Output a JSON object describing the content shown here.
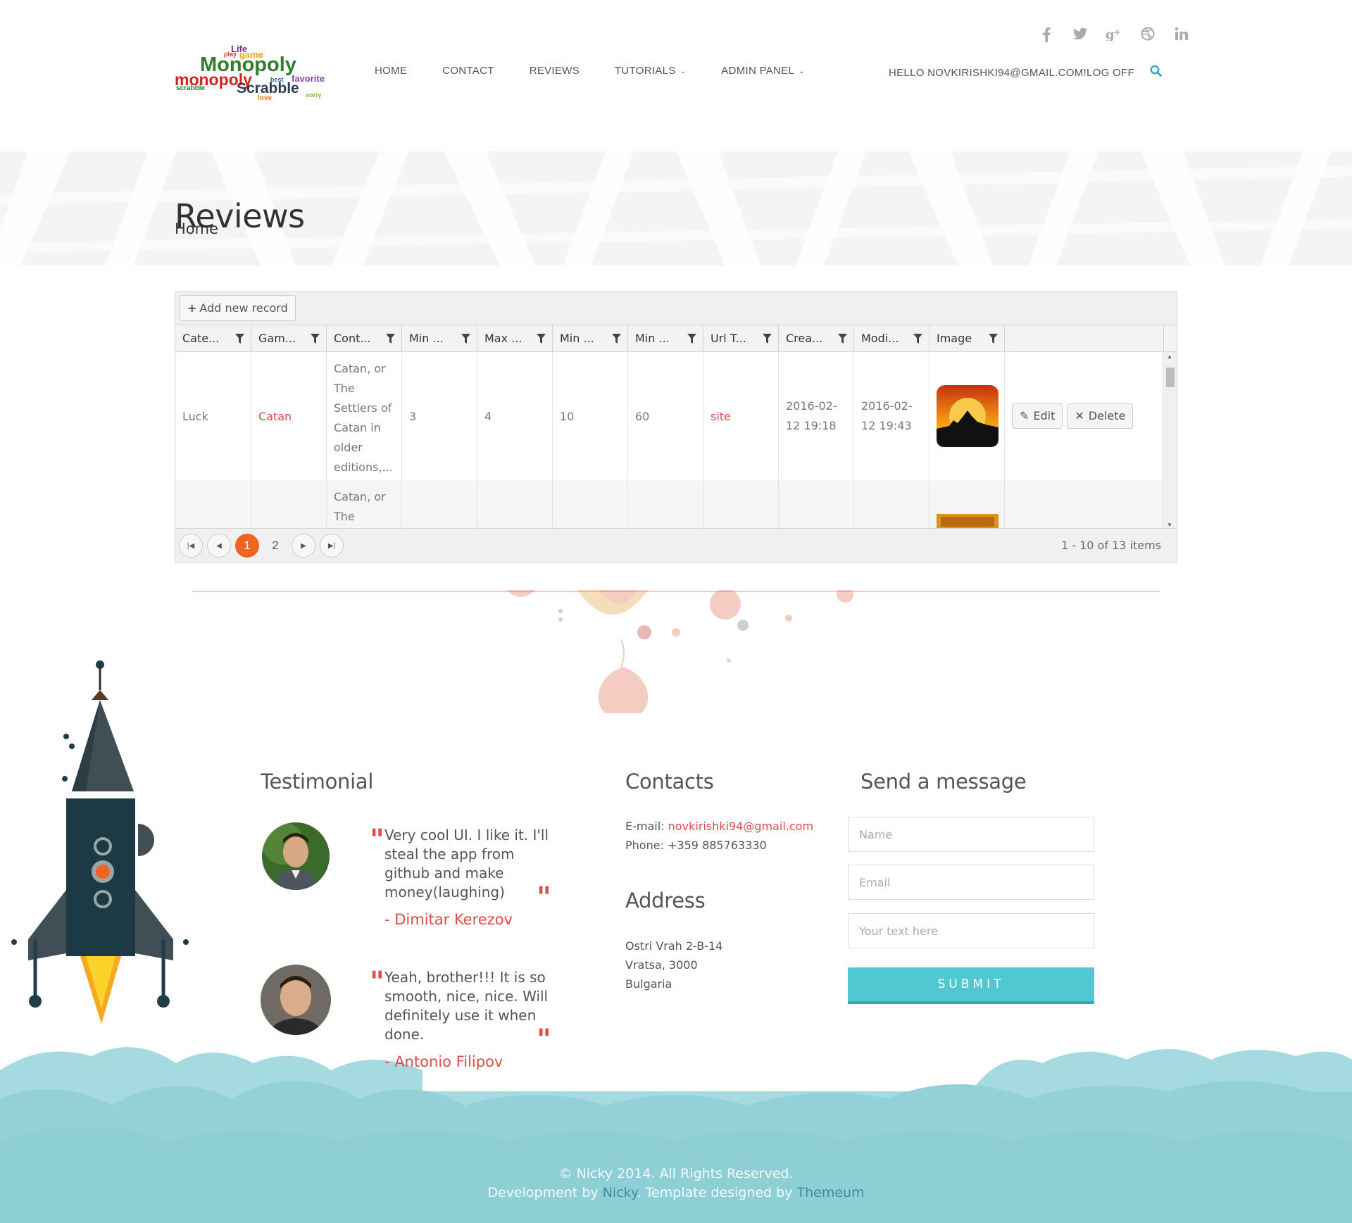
{
  "header": {
    "logo_words": [
      "Life",
      "play",
      "game",
      "Monopoly",
      "monopoly",
      "favorite",
      "scrabble",
      "best",
      "Scrabble",
      "sorry",
      "love"
    ],
    "nav": [
      {
        "label": "HOME"
      },
      {
        "label": "CONTACT"
      },
      {
        "label": "REVIEWS"
      },
      {
        "label": "TUTORIALS",
        "dropdown": true
      },
      {
        "label": "ADMIN PANEL",
        "dropdown": true
      }
    ],
    "hello": "HELLO NOVKIRISHKI94@GMAIL.COM!",
    "logoff": "LOG OFF",
    "social": [
      "facebook-icon",
      "twitter-icon",
      "google-plus-icon",
      "dribbble-icon",
      "linkedin-icon"
    ],
    "accent": "#2aa7cb"
  },
  "page": {
    "title": "Reviews",
    "breadcrumb": "Home"
  },
  "grid": {
    "add_label": "Add new record",
    "columns": [
      "Cate...",
      "Gam...",
      "Cont...",
      "Min ...",
      "Max ...",
      "Min ...",
      "Min ...",
      "Url T...",
      "Crea...",
      "Modi...",
      "Image"
    ],
    "rows": [
      {
        "category": "Luck",
        "game": "Catan",
        "content": "Catan, or\nThe\nSettlers of\nCatan in\nolder\neditions,...",
        "min_players": "3",
        "max_players": "4",
        "min_age": "10",
        "min_time": "60",
        "url": "site",
        "created": "2016-02-\n12 19:18",
        "modified": "2016-02-\n12 19:43",
        "edit_label": "Edit",
        "delete_label": "Delete"
      },
      {
        "content": "Catan, or\nThe"
      }
    ],
    "pager": {
      "pages": [
        "1",
        "2"
      ],
      "active": "1",
      "info": "1 - 10 of 13 items"
    },
    "accent": "#f26322"
  },
  "footer": {
    "testimonial_title": "Testimonial",
    "testimonials": [
      {
        "text": "Very cool UI. I like it. I'll steal the app from github and make money(laughing)",
        "author": "- Dimitar Kerezov"
      },
      {
        "text": "Yeah, brother!!! It is so smooth, nice, nice. Will definitely use it when done.",
        "author": "- Antonio Filipov"
      }
    ],
    "contacts_title": "Contacts",
    "email_label": "E-mail:",
    "email": "novkirishki94@gmail.com",
    "phone": "Phone: +359 885763330",
    "address_title": "Address",
    "address": [
      "Ostri Vrah 2-B-14",
      "Vratsa, 3000",
      "Bulgaria"
    ],
    "message_title": "Send a message",
    "name_placeholder": "Name",
    "email_placeholder": "Email",
    "text_placeholder": "Your text here",
    "submit": "SUBMIT",
    "copyright_line1": "© Nicky 2014. All Rights Reserved.",
    "copyright_pre": "Development by",
    "copyright_dev": "Nicky",
    "copyright_mid": ". Template designed by",
    "copyright_designer": "Themeum",
    "colors": {
      "red": "#e04b4b",
      "teal": "#4fc9cf",
      "cloud": "#8ecfd6"
    }
  }
}
